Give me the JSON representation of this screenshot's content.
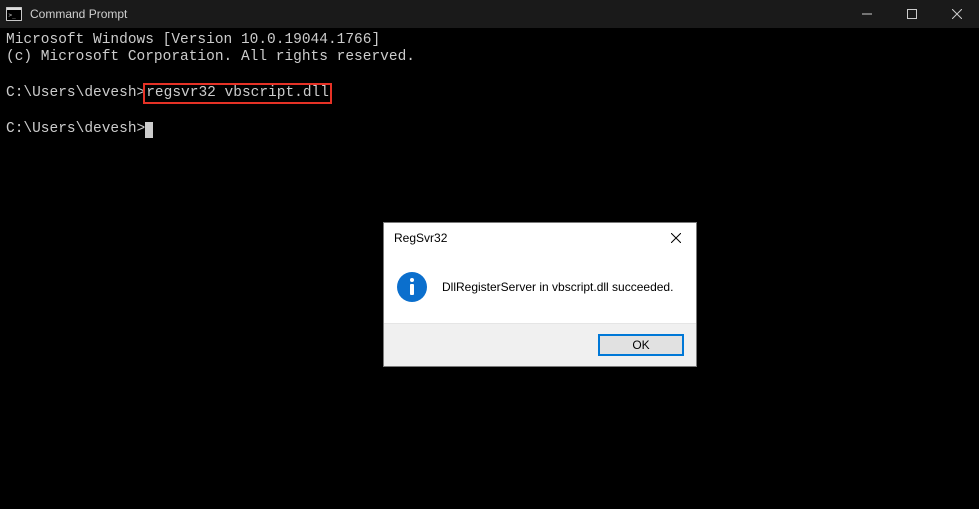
{
  "window": {
    "title": "Command Prompt"
  },
  "console": {
    "line1": "Microsoft Windows [Version 10.0.19044.1766]",
    "line2": "(c) Microsoft Corporation. All rights reserved.",
    "prompt1": "C:\\Users\\devesh>",
    "command1": "regsvr32 vbscript.dll",
    "prompt2": "C:\\Users\\devesh>"
  },
  "dialog": {
    "title": "RegSvr32",
    "message": "DllRegisterServer in vbscript.dll succeeded.",
    "ok_label": "OK"
  }
}
